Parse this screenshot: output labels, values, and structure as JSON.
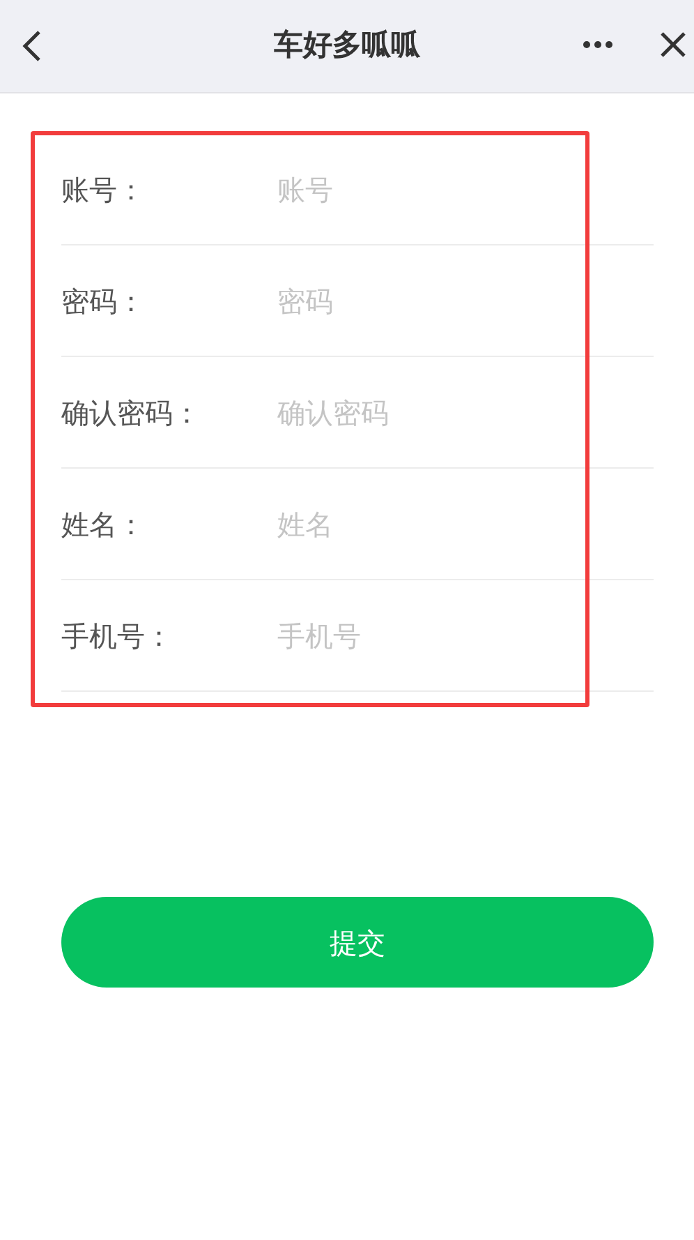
{
  "header": {
    "title": "车好多呱呱"
  },
  "form": {
    "fields": [
      {
        "label": "账号：",
        "placeholder": "账号"
      },
      {
        "label": "密码：",
        "placeholder": "密码"
      },
      {
        "label": "确认密码：",
        "placeholder": "确认密码"
      },
      {
        "label": "姓名：",
        "placeholder": "姓名"
      },
      {
        "label": "手机号：",
        "placeholder": "手机号"
      }
    ]
  },
  "submit_button": {
    "label": "提交"
  }
}
